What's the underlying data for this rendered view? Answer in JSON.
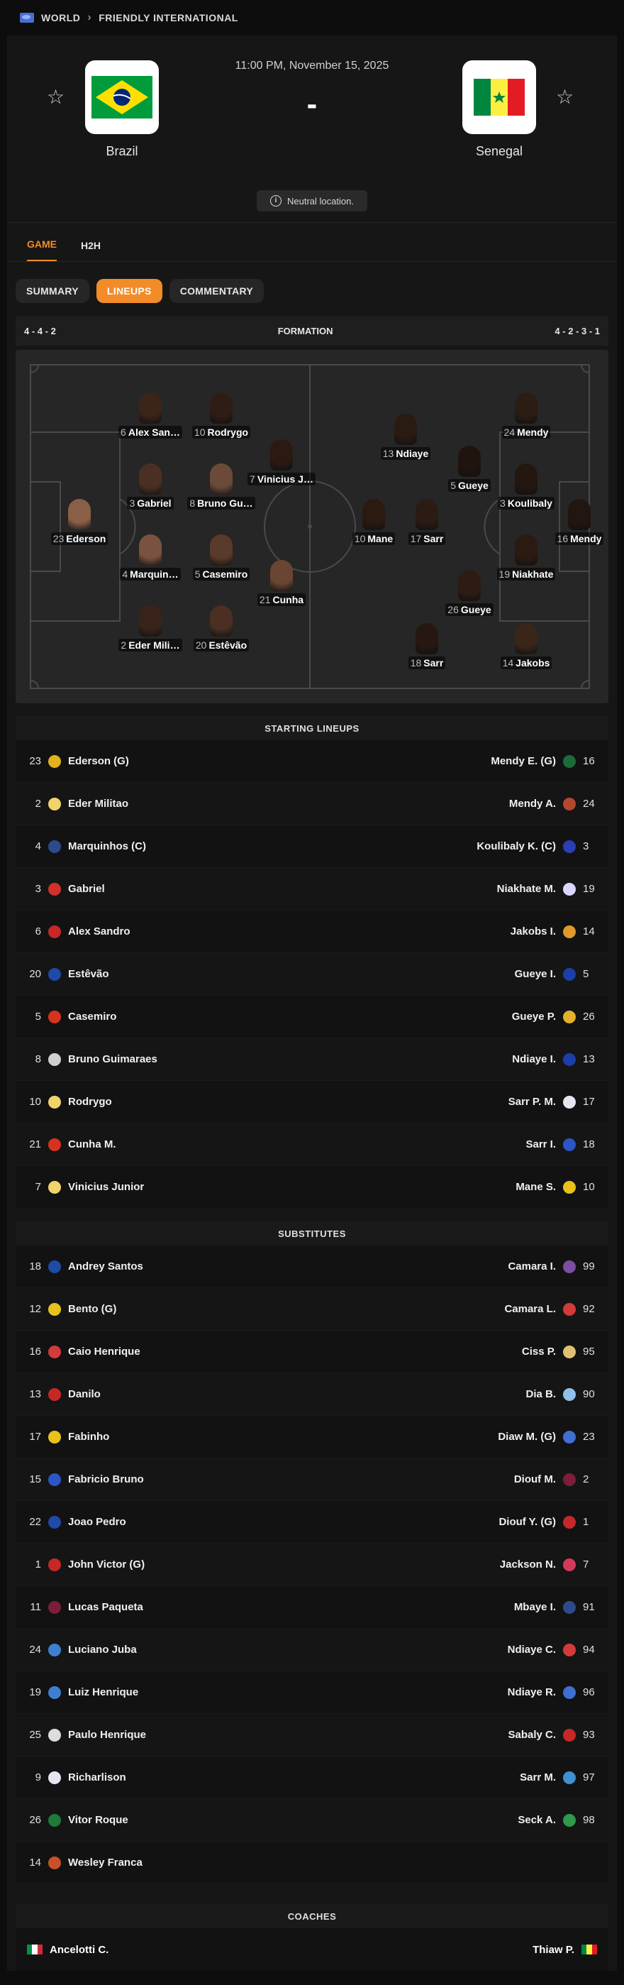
{
  "breadcrumb": {
    "region": "WORLD",
    "competition": "FRIENDLY INTERNATIONAL"
  },
  "match": {
    "datetime": "11:00 PM, November 15, 2025",
    "score": "-",
    "home": {
      "name": "Brazil",
      "flag_colors": [
        "#009c3b",
        "#ffdf00",
        "#002776"
      ]
    },
    "away": {
      "name": "Senegal",
      "flag_colors": [
        "#00853f",
        "#fdef42",
        "#e31b23"
      ]
    },
    "neutral_label": "Neutral location."
  },
  "tabs": [
    {
      "label": "GAME",
      "active": true
    },
    {
      "label": "H2H",
      "active": false
    }
  ],
  "subtabs": [
    {
      "label": "SUMMARY"
    },
    {
      "label": "LINEUPS",
      "active": true
    },
    {
      "label": "COMMENTARY"
    }
  ],
  "formation": {
    "home": "4 - 4 - 2",
    "title": "FORMATION",
    "away": "4 - 2 - 3 - 1"
  },
  "pitch_players": [
    {
      "num": "6",
      "name": "Alex San…",
      "skin": "#3b2418"
    },
    {
      "num": "10",
      "name": "Rodrygo",
      "skin": "#2e1d14"
    },
    {
      "num": "7",
      "name": "Vinicius J…",
      "skin": "#2a1a12"
    },
    {
      "num": "3",
      "name": "Gabriel",
      "skin": "#4a3024"
    },
    {
      "num": "8",
      "name": "Bruno Gu…",
      "skin": "#6b4a3a"
    },
    {
      "num": "23",
      "name": "Ederson",
      "skin": "#8a5f48"
    },
    {
      "num": "4",
      "name": "Marquin…",
      "skin": "#7a5240"
    },
    {
      "num": "5",
      "name": "Casemiro",
      "skin": "#5a3a2a"
    },
    {
      "num": "21",
      "name": "Cunha",
      "skin": "#6a4533"
    },
    {
      "num": "2",
      "name": "Eder Mili…",
      "skin": "#3a2419"
    },
    {
      "num": "20",
      "name": "Estêvão",
      "skin": "#4a2f22"
    },
    {
      "num": "13",
      "name": "Ndiaye",
      "skin": "#2a1a12"
    },
    {
      "num": "24",
      "name": "Mendy",
      "skin": "#2b1c14"
    },
    {
      "num": "5",
      "name": "Gueye",
      "skin": "#1f140e"
    },
    {
      "num": "3",
      "name": "Koulibaly",
      "skin": "#241710"
    },
    {
      "num": "10",
      "name": "Mane",
      "skin": "#2a1a12"
    },
    {
      "num": "17",
      "name": "Sarr",
      "skin": "#2b1b13"
    },
    {
      "num": "16",
      "name": "Mendy",
      "skin": "#221610"
    },
    {
      "num": "26",
      "name": "Gueye",
      "skin": "#2c1c14"
    },
    {
      "num": "19",
      "name": "Niakhate",
      "skin": "#2a1a12"
    },
    {
      "num": "18",
      "name": "Sarr",
      "skin": "#261811"
    },
    {
      "num": "14",
      "name": "Jakobs",
      "skin": "#3a2519"
    }
  ],
  "starting_title": "STARTING LINEUPS",
  "starting": [
    {
      "hn": "23",
      "home": "Ederson (G)",
      "hc": "#e3b11b",
      "away": "Mendy E. (G)",
      "an": "16",
      "ac": "#1e6b3a"
    },
    {
      "hn": "2",
      "home": "Eder Militao",
      "hc": "#f1d36b",
      "away": "Mendy A.",
      "an": "24",
      "ac": "#b5472d"
    },
    {
      "hn": "4",
      "home": "Marquinhos (C)",
      "hc": "#2d4a8a",
      "away": "Koulibaly K. (C)",
      "an": "3",
      "ac": "#2b3fb5"
    },
    {
      "hn": "3",
      "home": "Gabriel",
      "hc": "#d2302a",
      "away": "Niakhate M.",
      "an": "19",
      "ac": "#d8d8ff"
    },
    {
      "hn": "6",
      "home": "Alex Sandro",
      "hc": "#c62828",
      "away": "Jakobs I.",
      "an": "14",
      "ac": "#e09a2a"
    },
    {
      "hn": "20",
      "home": "Estêvão",
      "hc": "#1f4aa8",
      "away": "Gueye I.",
      "an": "5",
      "ac": "#1c3ea8"
    },
    {
      "hn": "5",
      "home": "Casemiro",
      "hc": "#d6331f",
      "away": "Gueye P.",
      "an": "26",
      "ac": "#e2b02a"
    },
    {
      "hn": "8",
      "home": "Bruno Guimaraes",
      "hc": "#cfcfcf",
      "away": "Ndiaye I.",
      "an": "13",
      "ac": "#1c3ea8"
    },
    {
      "hn": "10",
      "home": "Rodrygo",
      "hc": "#f1d36b",
      "away": "Sarr P. M.",
      "an": "17",
      "ac": "#e6e6f2"
    },
    {
      "hn": "21",
      "home": "Cunha M.",
      "hc": "#d6331f",
      "away": "Sarr I.",
      "an": "18",
      "ac": "#2c56c6"
    },
    {
      "hn": "7",
      "home": "Vinicius Junior",
      "hc": "#f1d36b",
      "away": "Mane S.",
      "an": "10",
      "ac": "#e8c21a"
    }
  ],
  "subs_title": "SUBSTITUTES",
  "subs": [
    {
      "hn": "18",
      "home": "Andrey Santos",
      "hc": "#1f4aa8",
      "away": "Camara I.",
      "an": "99",
      "ac": "#7b4da3"
    },
    {
      "hn": "12",
      "home": "Bento (G)",
      "hc": "#e8c21a",
      "away": "Camara L.",
      "an": "92",
      "ac": "#d33a3a"
    },
    {
      "hn": "16",
      "home": "Caio Henrique",
      "hc": "#d33a3a",
      "away": "Ciss P.",
      "an": "95",
      "ac": "#e0c070"
    },
    {
      "hn": "13",
      "home": "Danilo",
      "hc": "#c62828",
      "away": "Dia B.",
      "an": "90",
      "ac": "#8fc1ea"
    },
    {
      "hn": "17",
      "home": "Fabinho",
      "hc": "#e8c21a",
      "away": "Diaw M. (G)",
      "an": "23",
      "ac": "#3f6fd1"
    },
    {
      "hn": "15",
      "home": "Fabricio Bruno",
      "hc": "#2c56c6",
      "away": "Diouf M.",
      "an": "2",
      "ac": "#7a1e3a"
    },
    {
      "hn": "22",
      "home": "Joao Pedro",
      "hc": "#1f4aa8",
      "away": "Diouf Y. (G)",
      "an": "1",
      "ac": "#c62828"
    },
    {
      "hn": "1",
      "home": "John Victor (G)",
      "hc": "#c62828",
      "away": "Jackson N.",
      "an": "7",
      "ac": "#d33a5a"
    },
    {
      "hn": "11",
      "home": "Lucas Paqueta",
      "hc": "#7a1e3a",
      "away": "Mbaye I.",
      "an": "91",
      "ac": "#2d4a8a"
    },
    {
      "hn": "24",
      "home": "Luciano Juba",
      "hc": "#3f7fd1",
      "away": "Ndiaye C.",
      "an": "94",
      "ac": "#d33a3a"
    },
    {
      "hn": "19",
      "home": "Luiz Henrique",
      "hc": "#3f7fd1",
      "away": "Ndiaye R.",
      "an": "96",
      "ac": "#3f6fd1"
    },
    {
      "hn": "25",
      "home": "Paulo Henrique",
      "hc": "#dddddd",
      "away": "Sabaly C.",
      "an": "93",
      "ac": "#c62828"
    },
    {
      "hn": "9",
      "home": "Richarlison",
      "hc": "#e6e6f2",
      "away": "Sarr M.",
      "an": "97",
      "ac": "#3f8fd1"
    },
    {
      "hn": "26",
      "home": "Vitor Roque",
      "hc": "#1e7a3a",
      "away": "Seck A.",
      "an": "98",
      "ac": "#2f9a4a"
    },
    {
      "hn": "14",
      "home": "Wesley Franca",
      "hc": "#c8512a",
      "away": "",
      "an": "",
      "ac": ""
    }
  ],
  "coaches_title": "COACHES",
  "coaches": {
    "home": "Ancelotti C.",
    "away": "Thiaw P.",
    "home_flag": [
      "#009246",
      "#ffffff",
      "#ce2b37"
    ],
    "away_flag": [
      "#00853f",
      "#fdef42",
      "#e31b23"
    ]
  }
}
